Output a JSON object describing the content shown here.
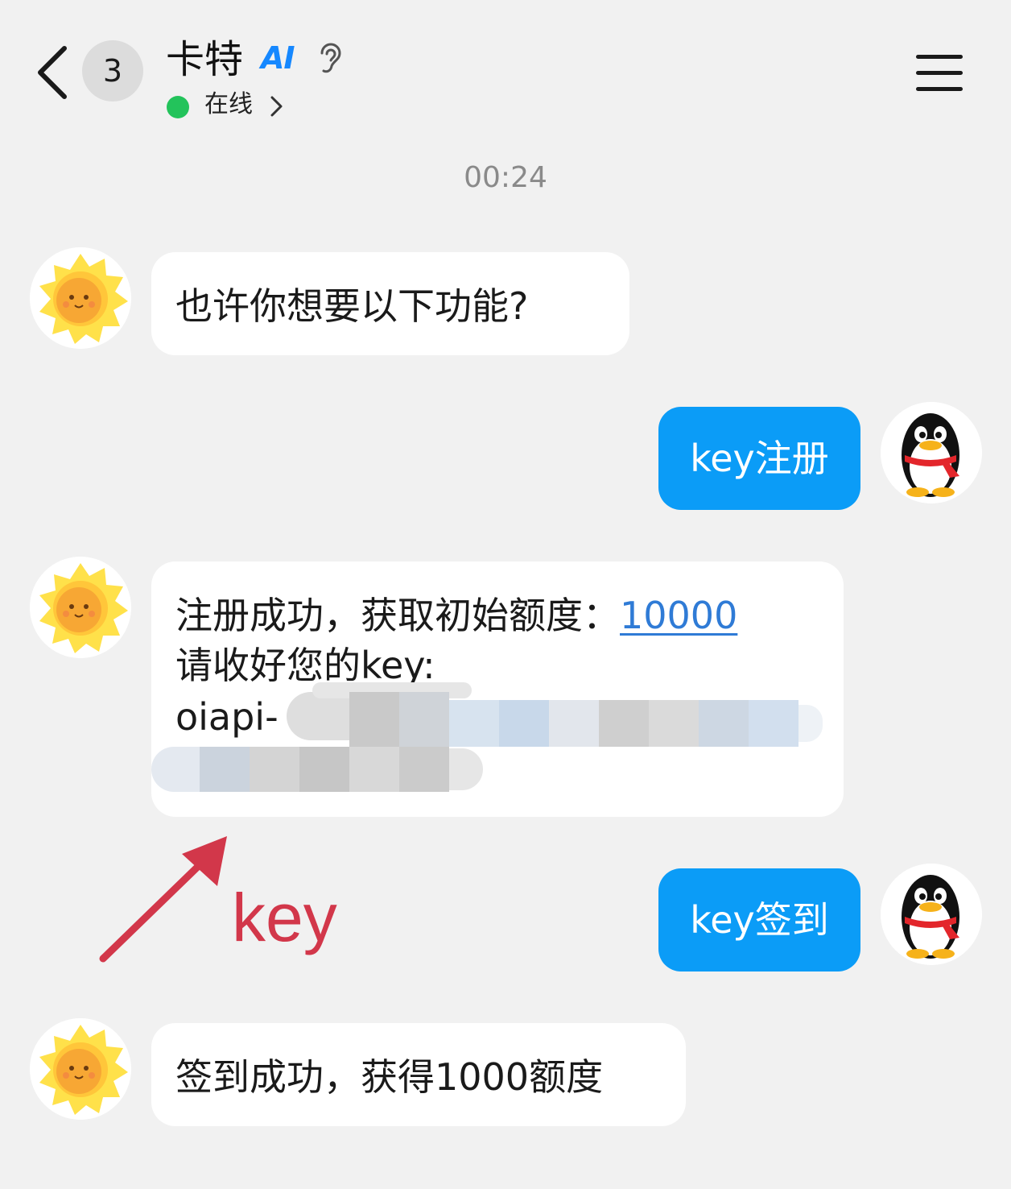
{
  "header": {
    "back": "back",
    "unread_count": "3",
    "contact_name": "卡特",
    "ai_badge": "AI",
    "status": "在线",
    "menu": "menu"
  },
  "timestamp": "00:24",
  "messages": [
    {
      "from": "bot",
      "text": "也许你想要以下功能?"
    },
    {
      "from": "user",
      "text": "key注册"
    },
    {
      "from": "bot",
      "line1_prefix": "注册成功，获取初始额度：",
      "line1_amount": "10000",
      "line2": "请收好您的key:",
      "line3_prefix": "oiapi-",
      "key_redacted": true
    },
    {
      "from": "user",
      "text": "key签到"
    },
    {
      "from": "bot",
      "text": "签到成功，获得1000额度"
    }
  ],
  "annotation": {
    "label": "key",
    "color": "#d2374a"
  },
  "colors": {
    "background": "#f1f1f1",
    "outgoing_bubble": "#0b9cf7",
    "incoming_bubble": "#ffffff",
    "online_dot": "#23c35b",
    "ai_badge": "#1688ff",
    "link": "#2f7bd6"
  },
  "icons": [
    "chevron-left-icon",
    "ear-icon",
    "chevron-right-icon",
    "hamburger-menu-icon",
    "sun-avatar-icon",
    "penguin-avatar-icon",
    "arrow-icon"
  ]
}
